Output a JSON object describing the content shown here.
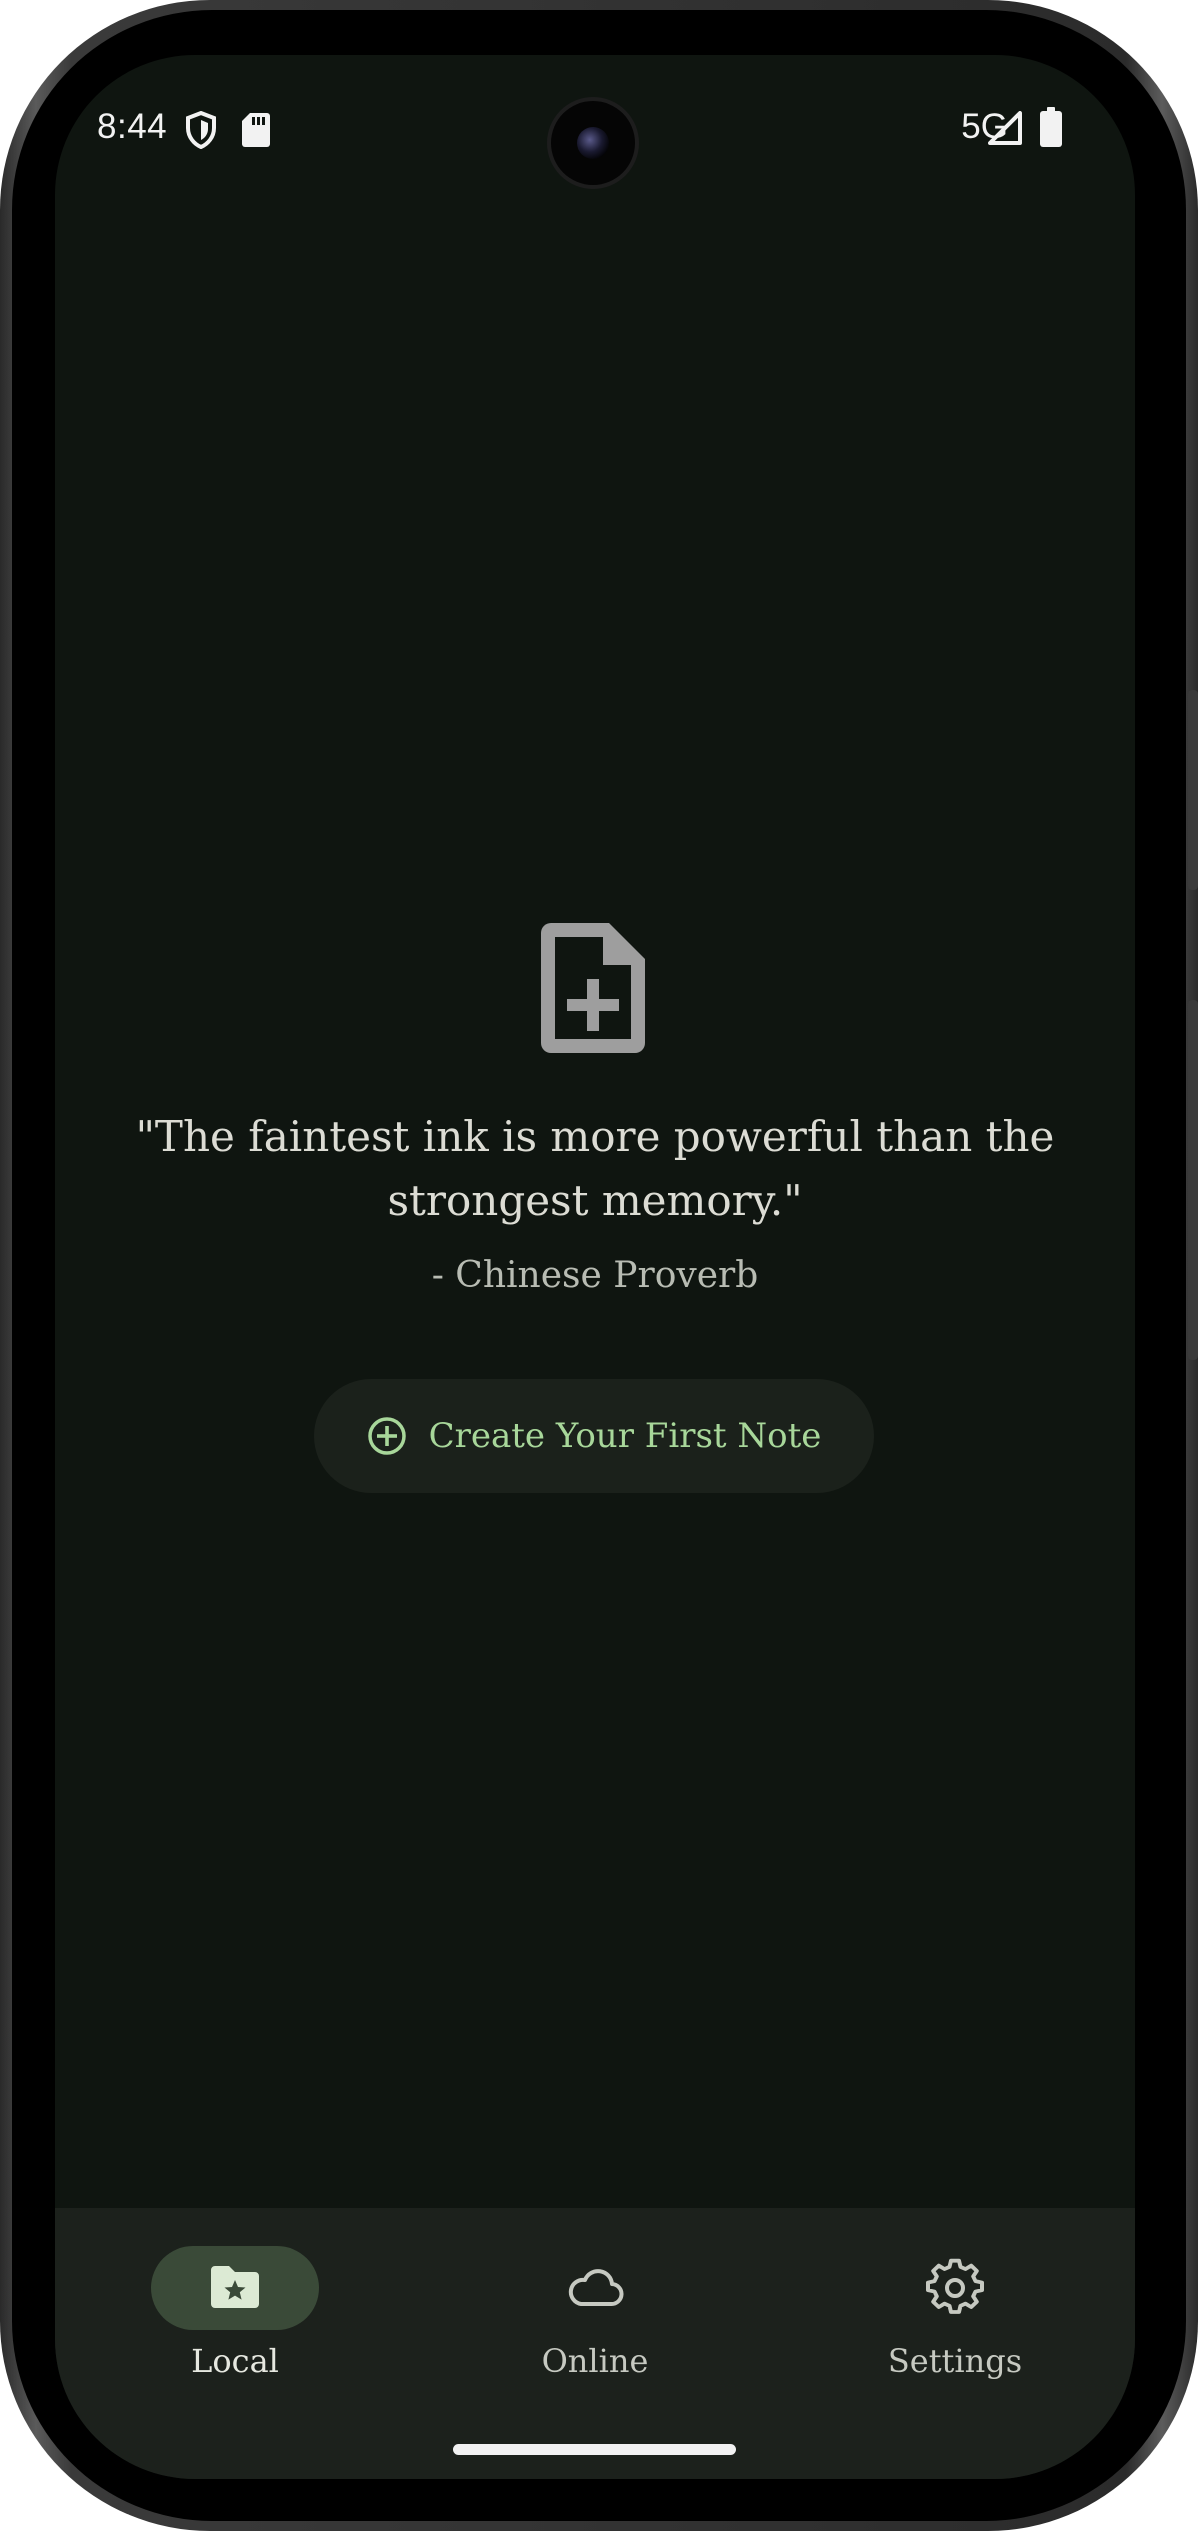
{
  "status_bar": {
    "time": "8:44",
    "network": "5G",
    "icons": [
      "shield-icon",
      "sd-card-icon",
      "signal-icon",
      "battery-icon"
    ]
  },
  "empty_state": {
    "icon": "add-document-icon",
    "quote": "\"The faintest ink is more powerful than the strongest memory.\"",
    "attribution": "- Chinese Proverb",
    "create_button": {
      "label": "Create Your First Note",
      "icon": "add-circle-icon"
    }
  },
  "bottom_nav": {
    "items": [
      {
        "label": "Local",
        "icon": "folder-star-icon",
        "selected": true
      },
      {
        "label": "Online",
        "icon": "cloud-icon",
        "selected": false
      },
      {
        "label": "Settings",
        "icon": "gear-icon",
        "selected": false
      }
    ]
  },
  "colors": {
    "background": "#0f1510",
    "accent": "#a8d79a",
    "nav_background": "#1c211c",
    "nav_selected_pill": "#3a4a38"
  }
}
